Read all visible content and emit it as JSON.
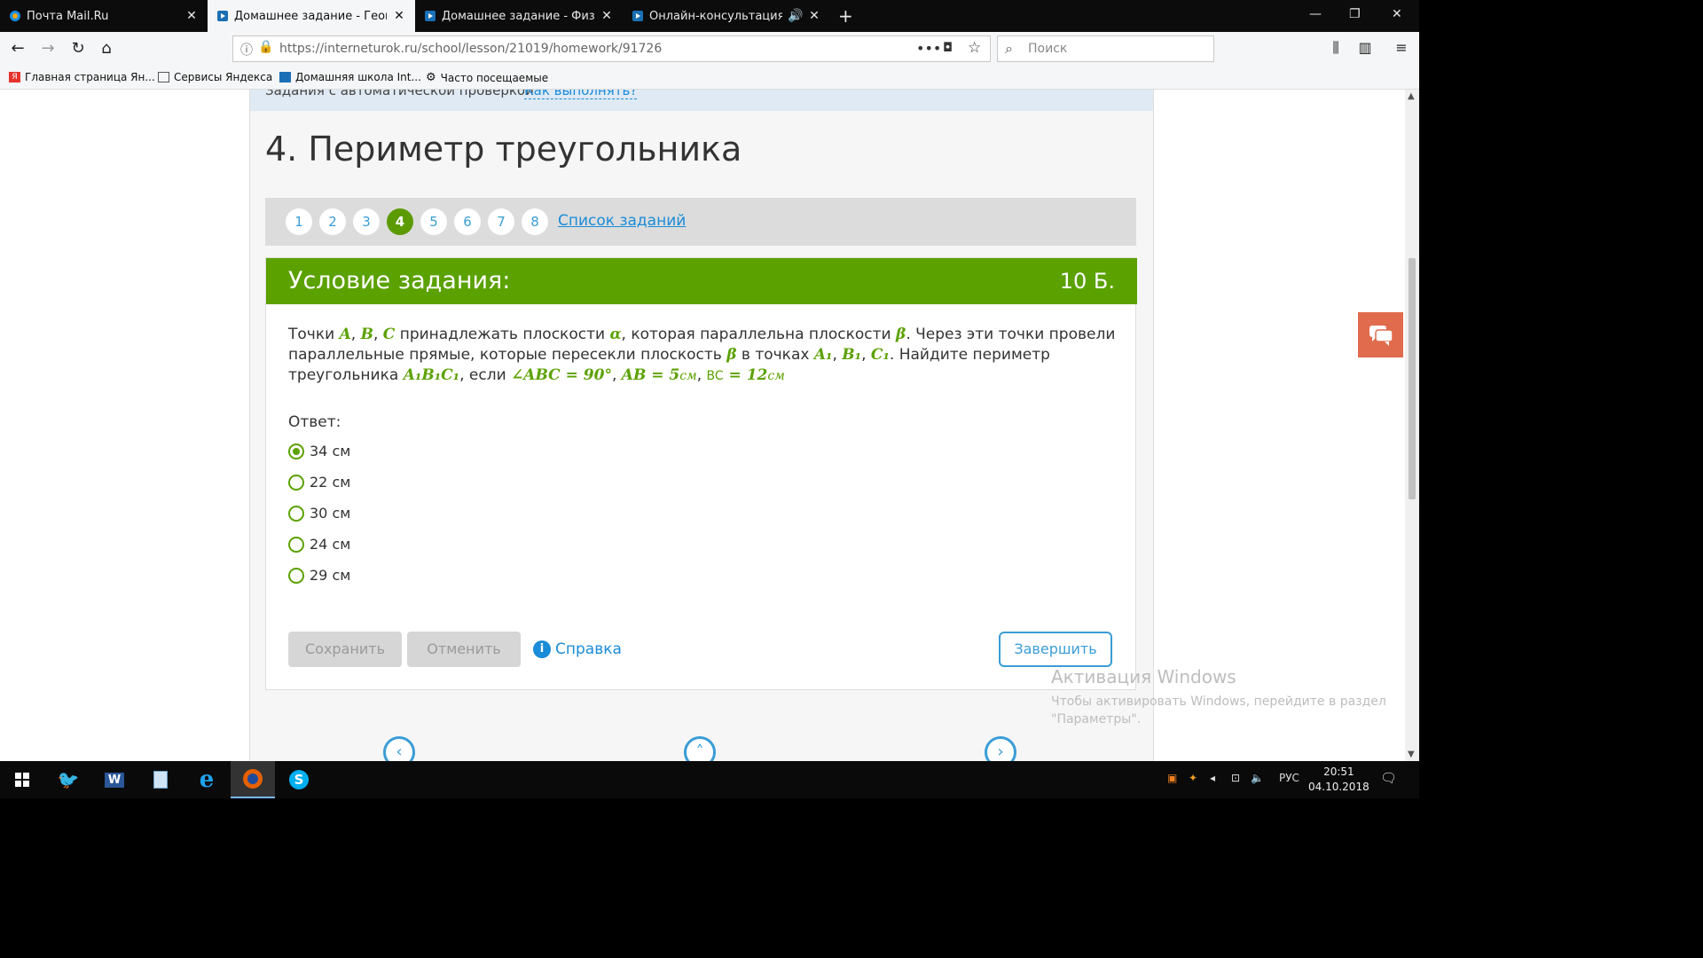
{
  "browser": {
    "tabs": [
      {
        "title": "Почта Mail.Ru",
        "active": false
      },
      {
        "title": "Домашнее задание - Геометр",
        "active": true
      },
      {
        "title": "Домашнее задание - Физика",
        "active": false
      },
      {
        "title": "Онлайн-консультация - О",
        "active": false
      }
    ],
    "url": "https://interneturok.ru/school/lesson/21019/homework/91726",
    "search_placeholder": "Поиск",
    "bookmarks": [
      "Главная страница Ян...",
      "Сервисы Яндекса",
      "Домашняя школа Int...",
      "Часто посещаемые"
    ]
  },
  "page": {
    "strip_text": "Задания с автоматической проверкой",
    "strip_link": "Как выполнять?",
    "title": "4. Периметр треугольника",
    "pager": {
      "pages": [
        "1",
        "2",
        "3",
        "4",
        "5",
        "6",
        "7",
        "8"
      ],
      "current": "4",
      "task_list_link": "Список заданий"
    },
    "task": {
      "header": "Условие задания:",
      "score": "10 Б.",
      "text": {
        "t1": "Точки ",
        "A": "A",
        "c1": ", ",
        "B": "B",
        "c2": ", ",
        "C": "C",
        "t2": " принадлежать плоскости ",
        "alpha": "α",
        "t3": ", которая параллельна плоскости ",
        "beta": "β",
        "t4": ". Через эти точки провели параллельные прямые, которые пересекли плоскость ",
        "beta2": "β",
        "t5": " в точках ",
        "A1": "A₁",
        "c3": ", ",
        "B1": "B₁",
        "c4": ", ",
        "C1": "C₁",
        "t6": ". Найдите периметр треугольника ",
        "tri": "A₁B₁C₁",
        "t7": ", если ",
        "angle": "∠ABC = 90°",
        "c5": ", ",
        "ab": "AB = 5",
        "ab_unit": "см",
        "c6": ", ",
        "bc_label": "BC",
        "bc": " = 12",
        "bc_unit": "см"
      },
      "answer_label": "Ответ:",
      "options": [
        {
          "label": "34 см",
          "selected": true
        },
        {
          "label": "22 см",
          "selected": false
        },
        {
          "label": "30 см",
          "selected": false
        },
        {
          "label": "24 см",
          "selected": false
        },
        {
          "label": "29 см",
          "selected": false
        }
      ],
      "buttons": {
        "save": "Сохранить",
        "cancel": "Отменить",
        "help": "Справка",
        "finish": "Завершить"
      }
    }
  },
  "watermark": {
    "title": "Активация Windows",
    "text": "Чтобы активировать Windows, перейдите в раздел \"Параметры\"."
  },
  "taskbar": {
    "lang": "РУС",
    "time": "20:51",
    "date": "04.10.2018"
  },
  "colors": {
    "accent_green": "#5ba100",
    "link_blue": "#1a8cd8",
    "chat_orange": "#e06b4d"
  }
}
